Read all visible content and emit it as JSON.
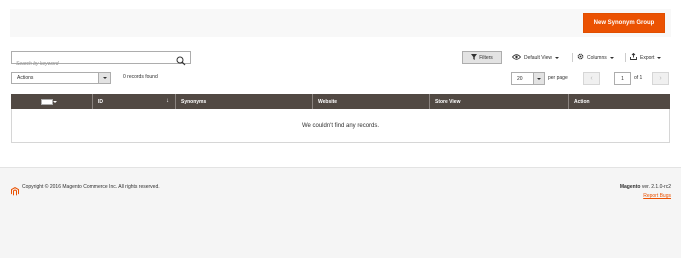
{
  "header": {
    "primary_button_label": "New Synonym Group"
  },
  "toolbar": {
    "search_placeholder": "Search by keyword",
    "filters_label": "Filters",
    "view_label": "Default View",
    "columns_label": "Columns",
    "export_label": "Export",
    "actions_label": "Actions",
    "records_found": "0 records found",
    "per_page_value": "20",
    "per_page_label": "per page",
    "current_page": "1",
    "page_total": "of 1"
  },
  "grid": {
    "columns": [
      "ID",
      "Synonyms",
      "Website",
      "Store View",
      "Action"
    ],
    "empty_message": "We couldn't find any records."
  },
  "footer": {
    "copyright": "Copyright © 2016 Magento Commerce Inc. All rights reserved.",
    "brand": "Magento",
    "version": "ver. 2.1.0-rc2",
    "report_bugs": "Report Bugs"
  },
  "colors": {
    "accent": "#eb5202",
    "grid_header": "#514943",
    "footer_bg": "#f5f5f5"
  },
  "icons": [
    "search-icon",
    "filter-icon",
    "eye-icon",
    "gear-icon",
    "export-icon",
    "magento-logo-icon"
  ]
}
